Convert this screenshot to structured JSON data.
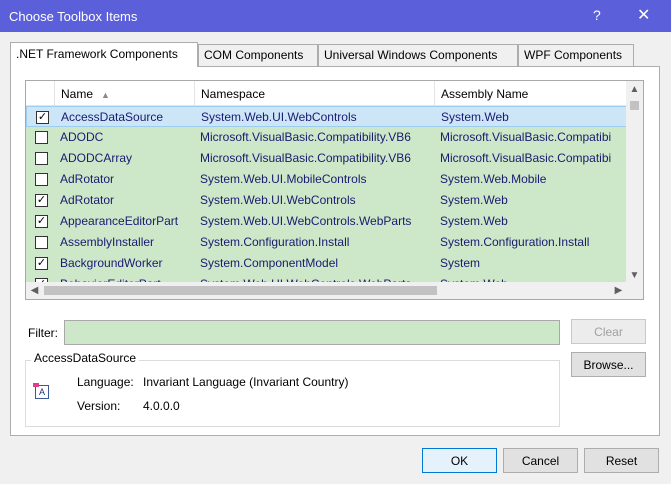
{
  "window": {
    "title": "Choose Toolbox Items",
    "help_glyph": "?",
    "close_glyph": "✕"
  },
  "tabs": [
    {
      "label": ".NET Framework Components",
      "active": true
    },
    {
      "label": "COM Components",
      "active": false
    },
    {
      "label": "Universal Windows Components",
      "active": false
    },
    {
      "label": "WPF Components",
      "active": false
    }
  ],
  "columns": {
    "name": "Name",
    "namespace": "Namespace",
    "assembly": "Assembly Name"
  },
  "rows": [
    {
      "checked": true,
      "name": "AccessDataSource",
      "namespace": "System.Web.UI.WebControls",
      "assembly": "System.Web",
      "selected": true
    },
    {
      "checked": false,
      "name": "ADODC",
      "namespace": "Microsoft.VisualBasic.Compatibility.VB6",
      "assembly": "Microsoft.VisualBasic.Compatibi"
    },
    {
      "checked": false,
      "name": "ADODCArray",
      "namespace": "Microsoft.VisualBasic.Compatibility.VB6",
      "assembly": "Microsoft.VisualBasic.Compatibi"
    },
    {
      "checked": false,
      "name": "AdRotator",
      "namespace": "System.Web.UI.MobileControls",
      "assembly": "System.Web.Mobile"
    },
    {
      "checked": true,
      "name": "AdRotator",
      "namespace": "System.Web.UI.WebControls",
      "assembly": "System.Web"
    },
    {
      "checked": true,
      "name": "AppearanceEditorPart",
      "namespace": "System.Web.UI.WebControls.WebParts",
      "assembly": "System.Web"
    },
    {
      "checked": false,
      "name": "AssemblyInstaller",
      "namespace": "System.Configuration.Install",
      "assembly": "System.Configuration.Install"
    },
    {
      "checked": true,
      "name": "BackgroundWorker",
      "namespace": "System.ComponentModel",
      "assembly": "System"
    },
    {
      "checked": true,
      "name": "BehaviorEditorPart",
      "namespace": "System.Web.UI.WebControls.WebParts",
      "assembly": "System.Web"
    }
  ],
  "filter": {
    "label": "Filter:",
    "value": ""
  },
  "buttons": {
    "clear": "Clear",
    "browse": "Browse...",
    "ok": "OK",
    "cancel": "Cancel",
    "reset": "Reset"
  },
  "info": {
    "title": "AccessDataSource",
    "language_label": "Language:",
    "language_value": "Invariant Language (Invariant Country)",
    "version_label": "Version:",
    "version_value": "4.0.0.0"
  },
  "colors": {
    "titlebar": "#5b5fd9",
    "row_background": "#cde8c8",
    "selected_row": "#cce6f7",
    "text": "#1a1a70"
  }
}
